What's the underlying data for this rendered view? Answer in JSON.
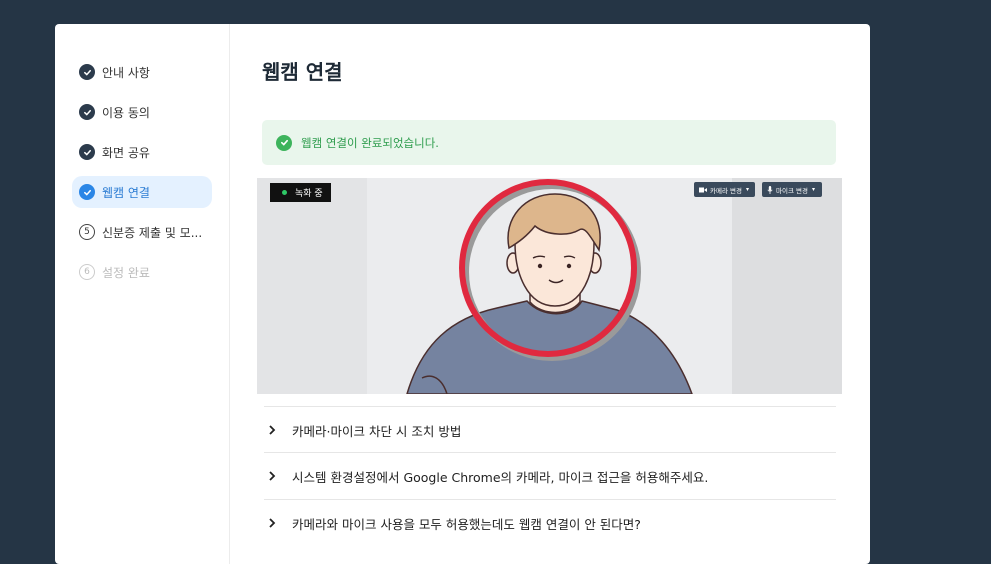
{
  "sidebar": {
    "steps": [
      {
        "label": "안내 사항",
        "state": "done"
      },
      {
        "label": "이용 동의",
        "state": "done"
      },
      {
        "label": "화면 공유",
        "state": "done"
      },
      {
        "label": "웹캠 연결",
        "state": "active"
      },
      {
        "label": "신분증 제출 및 모...",
        "state": "current",
        "number": "5"
      },
      {
        "label": "설정 완료",
        "state": "todo",
        "number": "6"
      }
    ]
  },
  "main": {
    "title": "웹캠 연결",
    "alert": "웹캠 연결이 완료되었습니다.",
    "video": {
      "recording_label": "녹화 중",
      "camera_button": "카메라 변경",
      "mic_button": "마이크 변경"
    },
    "faq": [
      "카메라·마이크 차단 시 조치 방법",
      "시스템 환경설정에서 Google Chrome의 카메라, 마이크 접근을 허용해주세요.",
      "카메라와 마이크 사용을 모두 허용했는데도 웹캠 연결이 안 된다면?"
    ]
  },
  "colors": {
    "background": "#253545",
    "active_step": "#2b86e6",
    "success": "#3db45c",
    "face_guide_ring": "#e0293f"
  }
}
